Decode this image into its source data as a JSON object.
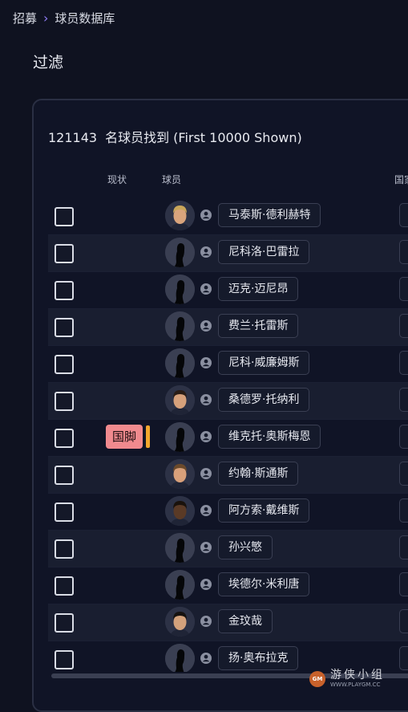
{
  "breadcrumb": {
    "parent": "招募",
    "separator": "›",
    "current": "球员数据库"
  },
  "filter_title": "过滤",
  "results": {
    "count": "121143",
    "label": "名球员找到 (First 10000 Shown)"
  },
  "columns": {
    "status": "现状",
    "player": "球员",
    "nation": "国家"
  },
  "players": [
    {
      "name": "马泰斯·德利赫特",
      "status": "",
      "avatar": "photo-blond"
    },
    {
      "name": "尼科洛·巴雷拉",
      "status": "",
      "avatar": "silhouette"
    },
    {
      "name": "迈克·迈尼昂",
      "status": "",
      "avatar": "silhouette"
    },
    {
      "name": "费兰·托雷斯",
      "status": "",
      "avatar": "silhouette"
    },
    {
      "name": "尼科·威廉姆斯",
      "status": "",
      "avatar": "silhouette"
    },
    {
      "name": "桑德罗·托纳利",
      "status": "",
      "avatar": "photo-dark-hair"
    },
    {
      "name": "维克托·奥斯梅恩",
      "status": "国脚",
      "avatar": "silhouette"
    },
    {
      "name": "约翰·斯通斯",
      "status": "",
      "avatar": "photo-brown-hair"
    },
    {
      "name": "阿方索·戴维斯",
      "status": "",
      "avatar": "photo-dark-skin"
    },
    {
      "name": "孙兴慜",
      "status": "",
      "avatar": "silhouette"
    },
    {
      "name": "埃德尔·米利唐",
      "status": "",
      "avatar": "silhouette"
    },
    {
      "name": "金玟哉",
      "status": "",
      "avatar": "photo-black-hair"
    },
    {
      "name": "扬·奥布拉克",
      "status": "",
      "avatar": "silhouette"
    }
  ],
  "icons": {
    "checkbox": "checkbox-icon",
    "person": "person-icon",
    "chevron": "chevron-right-icon"
  },
  "colors": {
    "background": "#0f1220",
    "accent": "#8f7cf5",
    "badge": "#f08a8e",
    "badge_bar": "#f2a72e"
  },
  "watermark": {
    "cn": "游侠小组",
    "url": "WWW.PLAYGM.CC",
    "logo": "GM"
  }
}
